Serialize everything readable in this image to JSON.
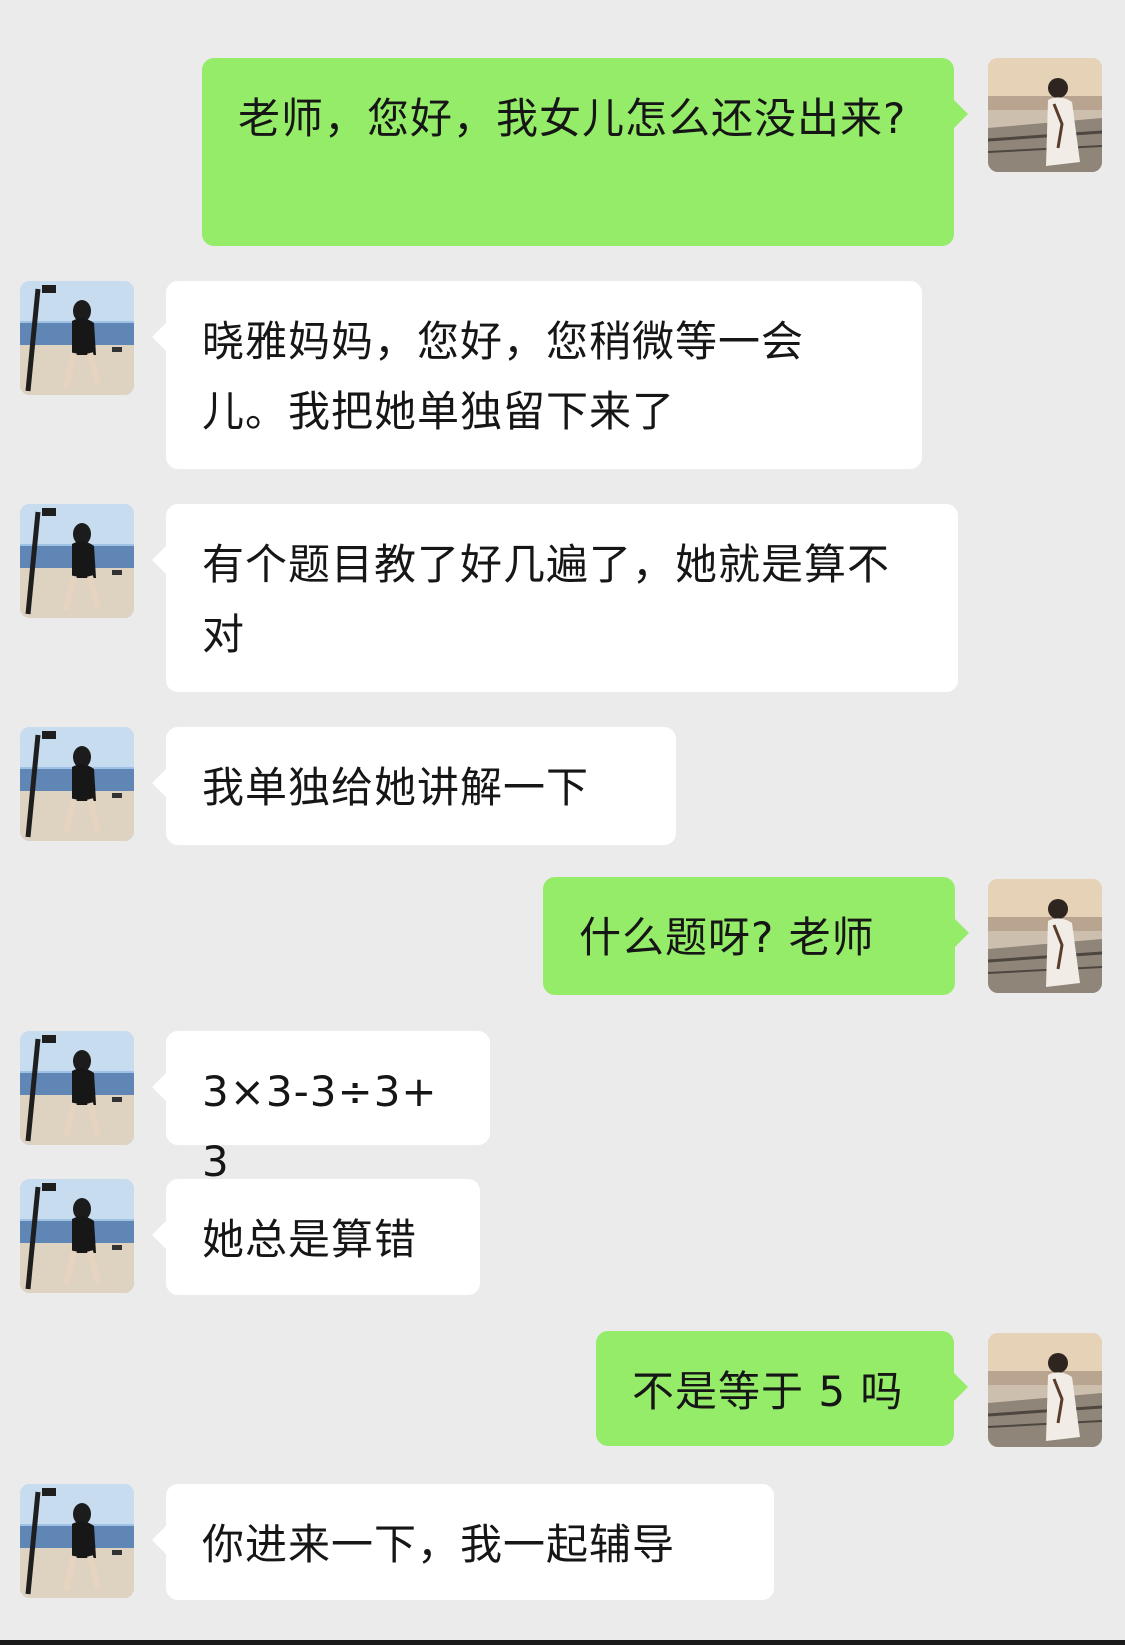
{
  "chat": {
    "messages": [
      {
        "side": "right",
        "sender": "parent",
        "avatar_icon": "parent-avatar-icon",
        "text": "老师，您好，我女儿怎么还没出来?"
      },
      {
        "side": "left",
        "sender": "teacher",
        "avatar_icon": "teacher-avatar-icon",
        "text": "晓雅妈妈，您好，您稍微等一会儿。我把她单独留下来了"
      },
      {
        "side": "left",
        "sender": "teacher",
        "avatar_icon": "teacher-avatar-icon",
        "text": "有个题目教了好几遍了，她就是算不对"
      },
      {
        "side": "left",
        "sender": "teacher",
        "avatar_icon": "teacher-avatar-icon",
        "text": "我单独给她讲解一下"
      },
      {
        "side": "right",
        "sender": "parent",
        "avatar_icon": "parent-avatar-icon",
        "text": "什么题呀? 老师"
      },
      {
        "side": "left",
        "sender": "teacher",
        "avatar_icon": "teacher-avatar-icon",
        "text": "3×3-3÷3+3"
      },
      {
        "side": "left",
        "sender": "teacher",
        "avatar_icon": "teacher-avatar-icon",
        "text": "她总是算错"
      },
      {
        "side": "right",
        "sender": "parent",
        "avatar_icon": "parent-avatar-icon",
        "text": "不是等于 5 吗"
      },
      {
        "side": "left",
        "sender": "teacher",
        "avatar_icon": "teacher-avatar-icon",
        "text": "你进来一下，我一起辅导"
      }
    ]
  },
  "colors": {
    "background": "#ebebeb",
    "bubble_self": "#95ec69",
    "bubble_other": "#ffffff",
    "text": "#161616"
  }
}
